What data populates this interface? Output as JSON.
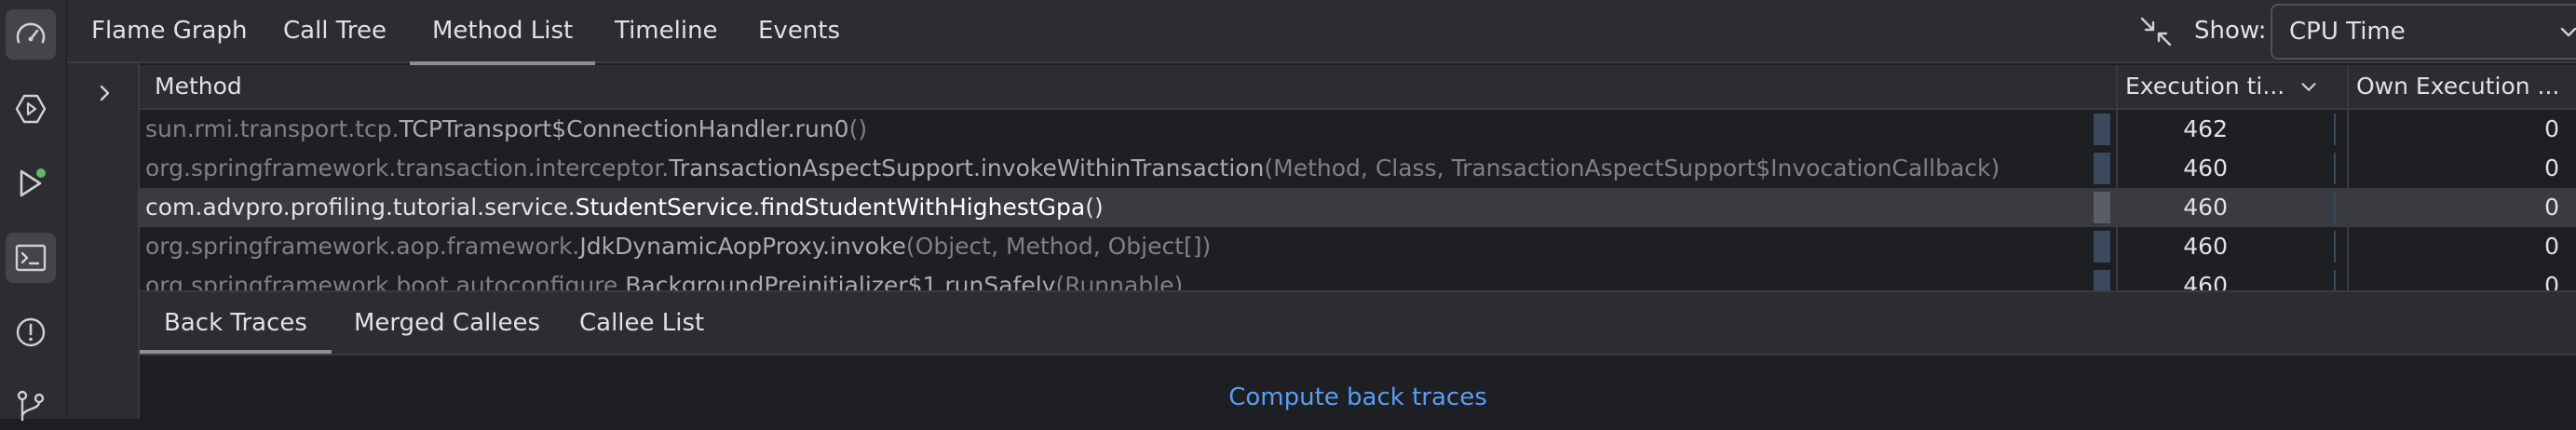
{
  "top_tabs": [
    {
      "label": "Flame Graph"
    },
    {
      "label": "Call Tree"
    },
    {
      "label": "Method List",
      "active": true
    },
    {
      "label": "Timeline"
    },
    {
      "label": "Events"
    }
  ],
  "show": {
    "label": "Show:",
    "value": "CPU Time"
  },
  "table": {
    "columns": {
      "method": "Method",
      "exec": "Execution ti...",
      "own": "Own Execution ..."
    },
    "rows": [
      {
        "pkg": "sun.rmi.transport.tcp.",
        "cls": "TCPTransport$ConnectionHandler.run0",
        "args": "()",
        "exec": "462",
        "own": "0"
      },
      {
        "pkg": "org.springframework.transaction.interceptor.",
        "cls": "TransactionAspectSupport.invokeWithinTransaction",
        "args": "(Method, Class, TransactionAspectSupport$InvocationCallback)",
        "exec": "460",
        "own": "0"
      },
      {
        "pkg": "com.advpro.profiling.tutorial.service.",
        "cls": "StudentService.findStudentWithHighestGpa",
        "args": "()",
        "exec": "460",
        "own": "0",
        "selected": true
      },
      {
        "pkg": "org.springframework.aop.framework.",
        "cls": "JdkDynamicAopProxy.invoke",
        "args": "(Object, Method, Object[])",
        "exec": "460",
        "own": "0"
      },
      {
        "pkg": "org.springframework.boot.autoconfigure.",
        "cls": "BackgroundPreinitializer$1.runSafely",
        "args": "(Runnable)",
        "exec": "460",
        "own": "0"
      }
    ]
  },
  "bottom_tabs": [
    {
      "label": "Back Traces",
      "active": true
    },
    {
      "label": "Merged Callees"
    },
    {
      "label": "Callee List"
    }
  ],
  "compute_link": "Compute back traces",
  "icons": {
    "strip": [
      "speedometer-icon",
      "run-configuration-icon",
      "run-with-badge-icon",
      "terminal-icon",
      "problems-icon",
      "git-icon"
    ],
    "collapse": "collapse-arrows-icon",
    "dropdown": "chevron-down-icon",
    "expand": "chevron-right-icon",
    "sort": "sort-descending-icon"
  },
  "colors": {
    "accent_link": "#589df6",
    "badge_green": "#5fb865",
    "selected_row": "#393b40"
  }
}
